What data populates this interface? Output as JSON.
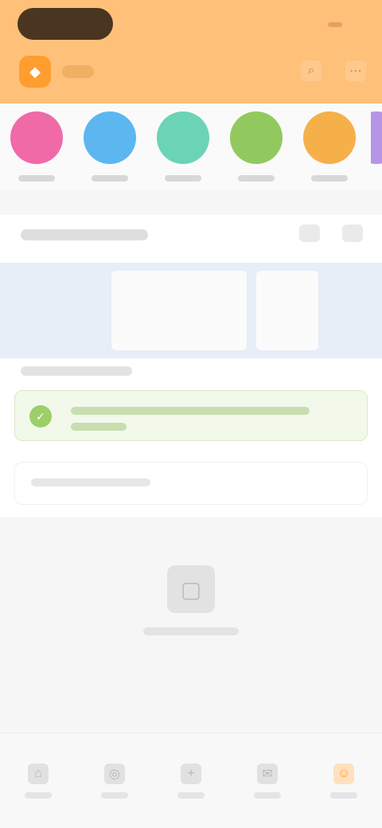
{
  "icons": {
    "logo": "app-logo-icon",
    "search": "search-icon",
    "more": "more-icon",
    "card_tool_1": "grid-icon",
    "card_tool_2": "minus-icon",
    "notice": "check-icon",
    "empty": "empty-box-icon",
    "nav": [
      "home-icon",
      "compass-icon",
      "add-icon",
      "chat-icon",
      "profile-icon"
    ]
  },
  "colors": {
    "header_bg": "#ffc07a",
    "accent": "#ff9d2e",
    "category": [
      "#f06aa8",
      "#5cb6f0",
      "#6bd3b6",
      "#92c95f",
      "#f6b04a",
      "#b695e6"
    ]
  }
}
